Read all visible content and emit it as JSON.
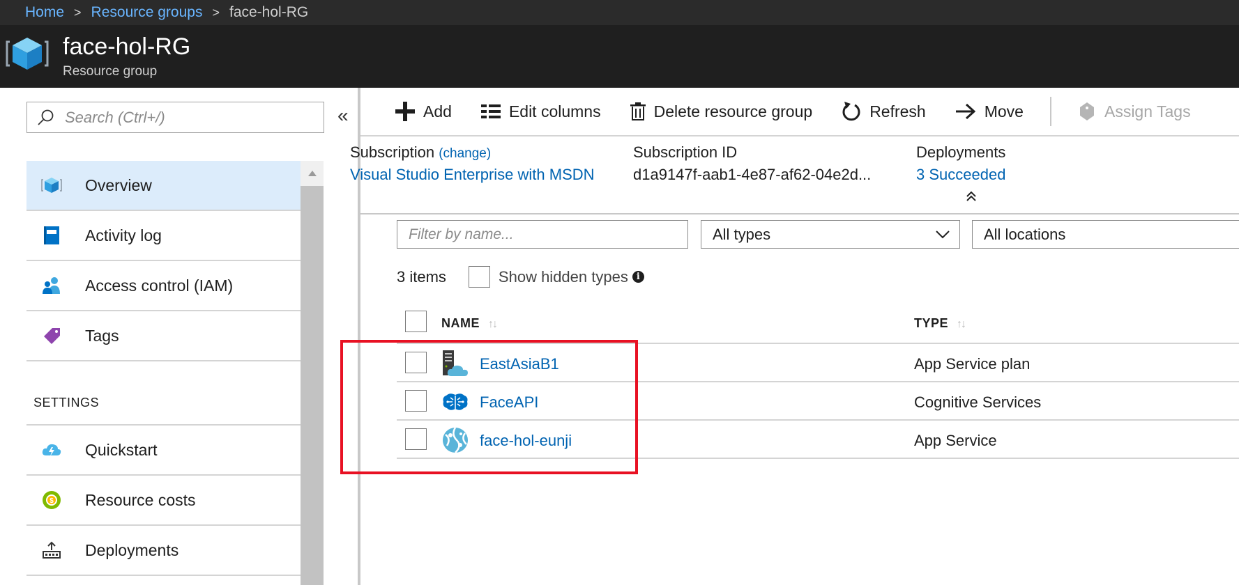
{
  "breadcrumb": {
    "home": "Home",
    "resource_groups": "Resource groups",
    "current": "face-hol-RG",
    "separator": ">"
  },
  "header": {
    "title": "face-hol-RG",
    "subtitle": "Resource group",
    "icon": "resource-group-cube-icon"
  },
  "sidebar": {
    "search_placeholder": "Search (Ctrl+/)",
    "collapse_glyph": "«",
    "items": [
      {
        "label": "Overview",
        "icon": "overview-cube-icon",
        "active": true
      },
      {
        "label": "Activity log",
        "icon": "activity-log-icon"
      },
      {
        "label": "Access control (IAM)",
        "icon": "users-icon"
      },
      {
        "label": "Tags",
        "icon": "tag-icon"
      }
    ],
    "settings_header": "SETTINGS",
    "settings_items": [
      {
        "label": "Quickstart",
        "icon": "cloud-bolt-icon"
      },
      {
        "label": "Resource costs",
        "icon": "coin-icon"
      },
      {
        "label": "Deployments",
        "icon": "upload-icon"
      }
    ]
  },
  "toolbar": {
    "add": "Add",
    "edit_columns": "Edit columns",
    "delete_rg": "Delete resource group",
    "refresh": "Refresh",
    "move": "Move",
    "assign_tags": "Assign Tags"
  },
  "essentials": {
    "subscription_label": "Subscription",
    "subscription_change": "(change)",
    "subscription_value": "Visual Studio Enterprise with MSDN",
    "subscription_id_label": "Subscription ID",
    "subscription_id_value": "d1a9147f-aab1-4e87-af62-04e2d...",
    "deployments_label": "Deployments",
    "deployments_value": "3 Succeeded"
  },
  "filters": {
    "name_placeholder": "Filter by name...",
    "types": "All types",
    "locations": "All locations"
  },
  "list": {
    "count": "3 items",
    "show_hidden": "Show hidden types",
    "col_name": "NAME",
    "col_type": "TYPE",
    "sort_glyph": "↑↓",
    "rows": [
      {
        "name": "EastAsiaB1",
        "type": "App Service plan",
        "icon": "app-service-plan-icon"
      },
      {
        "name": "FaceAPI",
        "type": "Cognitive Services",
        "icon": "cognitive-services-brain-icon"
      },
      {
        "name": "face-hol-eunji",
        "type": "App Service",
        "icon": "app-service-globe-icon"
      }
    ]
  },
  "colors": {
    "accent": "#0063b1",
    "highlight": "#e81123",
    "header_bg": "#1f1f1f",
    "active_nav_bg": "#dcecfb"
  }
}
